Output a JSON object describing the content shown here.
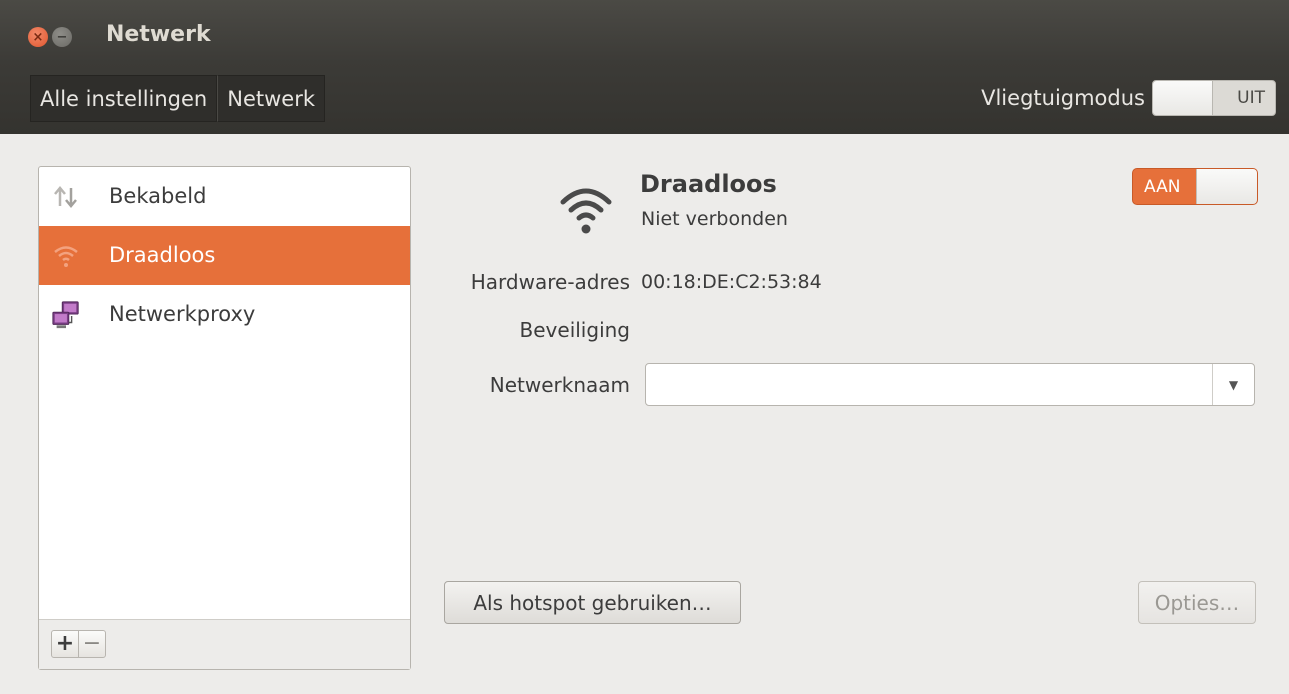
{
  "window": {
    "title": "Netwerk"
  },
  "toolbar": {
    "breadcrumbs": [
      {
        "label": "Alle instellingen"
      },
      {
        "label": "Netwerk"
      }
    ],
    "airplane_mode": {
      "label": "Vliegtuigmodus",
      "state": "UIT"
    }
  },
  "sidebar": {
    "items": [
      {
        "label": "Bekabeld",
        "icon": "wired-arrows-icon",
        "selected": false
      },
      {
        "label": "Draadloos",
        "icon": "wifi-icon",
        "selected": true
      },
      {
        "label": "Netwerkproxy",
        "icon": "network-proxy-icon",
        "selected": false
      }
    ],
    "add_label": "+",
    "remove_label": "−"
  },
  "device": {
    "name": "Draadloos",
    "status": "Niet verbonden",
    "switch_state": "AAN",
    "properties": {
      "hardware_label": "Hardware-adres",
      "hardware_value": "00:18:DE:C2:53:84",
      "security_label": "Beveiliging",
      "security_value": "",
      "network_name_label": "Netwerknaam",
      "network_name_value": ""
    },
    "hotspot_button": "Als hotspot gebruiken…",
    "options_button": "Opties…"
  },
  "colors": {
    "accent": "#e6703a",
    "titlebar": "#3c3b37",
    "background": "#edecea"
  }
}
